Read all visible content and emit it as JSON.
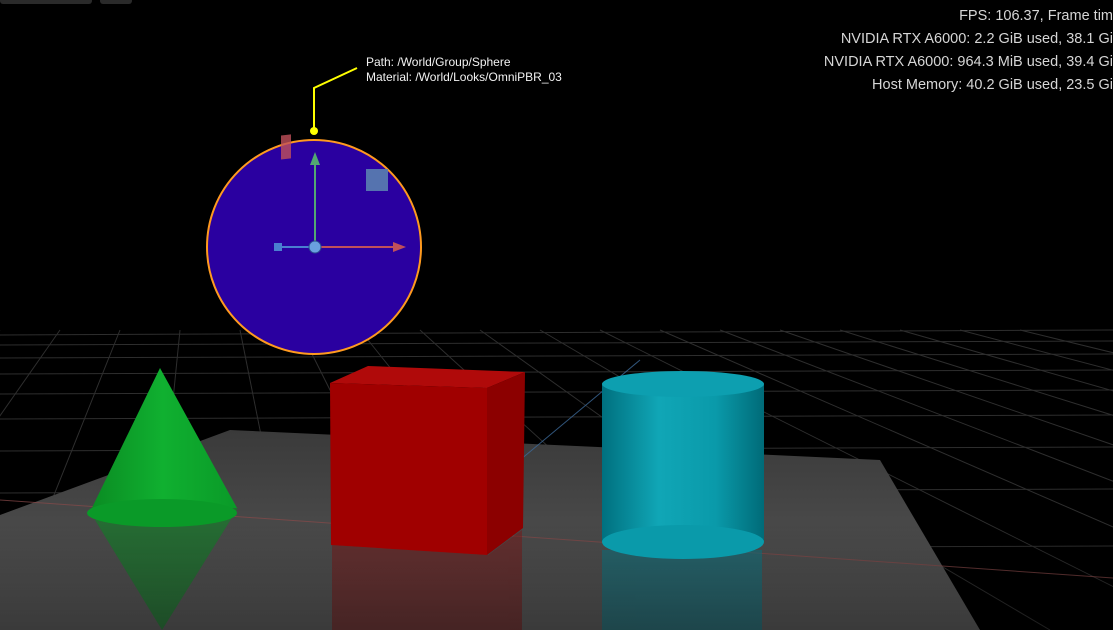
{
  "viewport": {
    "selection_tooltip": {
      "path": "Path: /World/Group/Sphere",
      "material": "Material: /World/Looks/OmniPBR_03"
    },
    "stats": {
      "fps_line": "FPS: 106.37, Frame tim",
      "gpu1_line": "NVIDIA RTX A6000: 2.2 GiB used,  38.1 Gi",
      "gpu2_line": "NVIDIA RTX A6000: 964.3 MiB used,  39.4 Gi",
      "host_line": "Host Memory: 40.2 GiB used, 23.5 Gi"
    },
    "objects": [
      {
        "name": "Sphere",
        "color": "#2a00a0",
        "selected": true
      },
      {
        "name": "Cone",
        "color": "#0aa22a"
      },
      {
        "name": "Cube",
        "color": "#a80000"
      },
      {
        "name": "Cylinder",
        "color": "#0097a8"
      }
    ],
    "colors": {
      "selection_outline": "#ff9a1f",
      "tooltip_leader": "#ffff00",
      "gizmo_x": "#c0505a",
      "gizmo_y": "#52a872",
      "gizmo_z": "#4a7fd0",
      "ground": "#4d4d4d",
      "grid": "#3a3a3a"
    }
  }
}
